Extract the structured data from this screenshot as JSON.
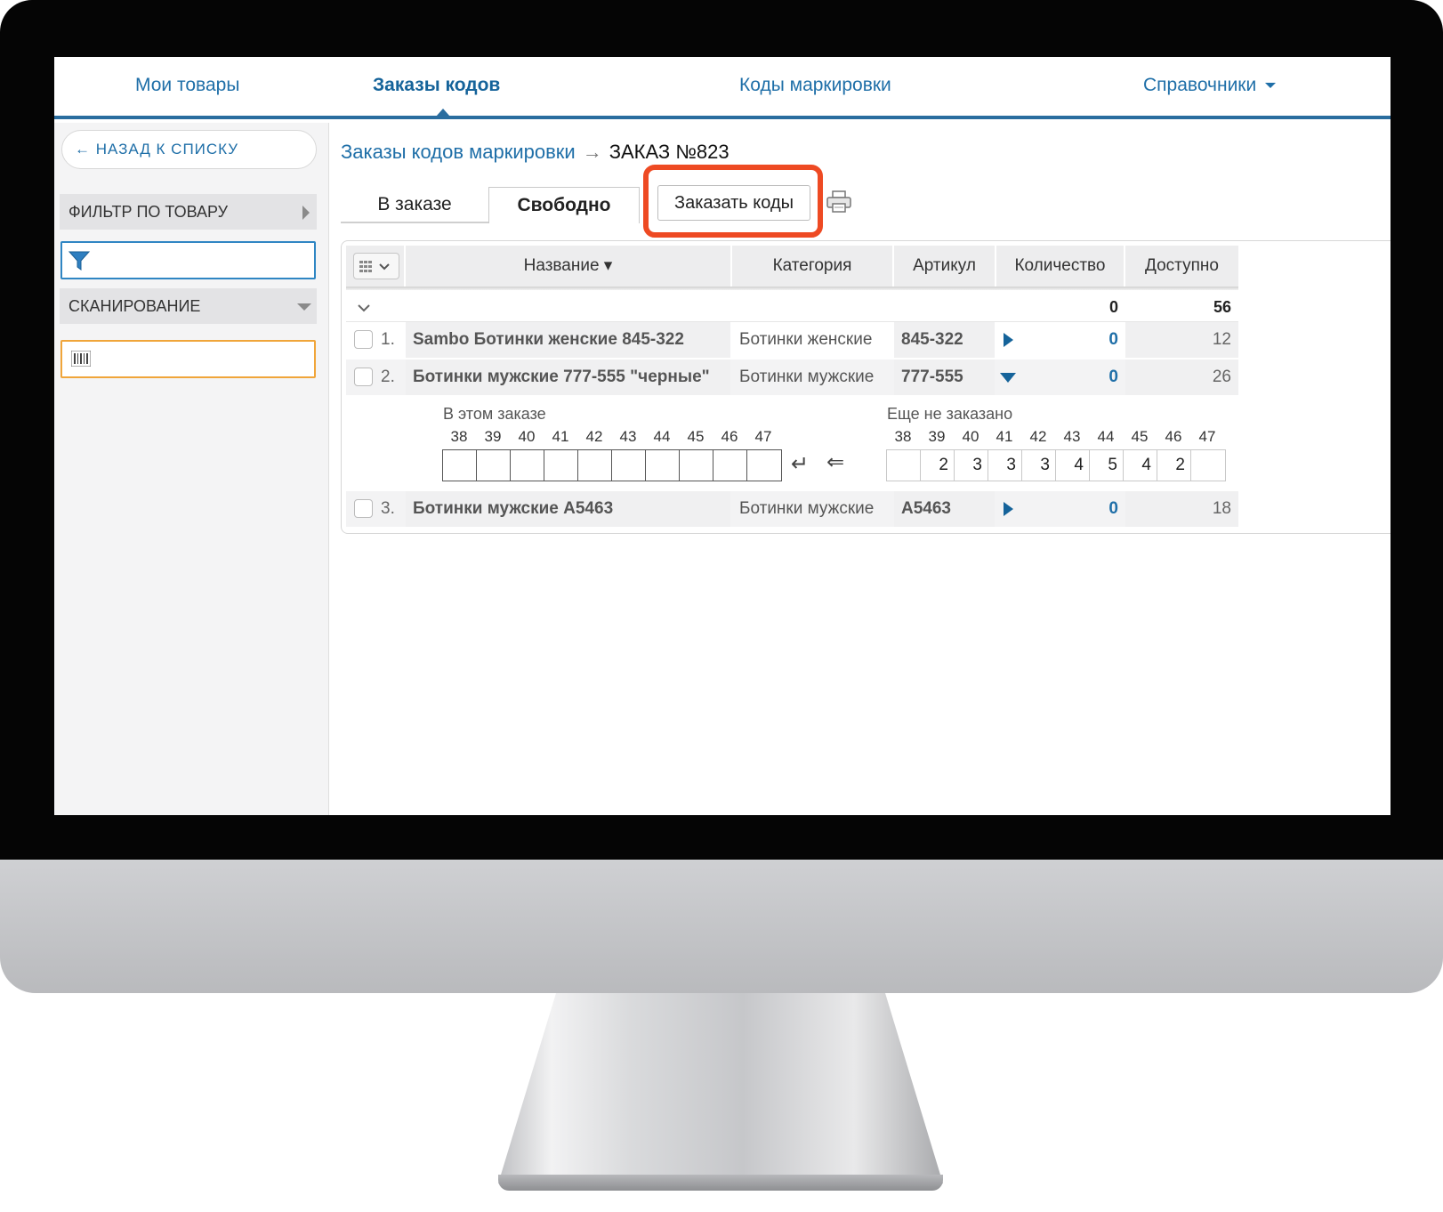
{
  "nav": {
    "items": [
      {
        "label": "Мои товары"
      },
      {
        "label": "Заказы кодов"
      },
      {
        "label": "Коды маркировки"
      },
      {
        "label": "Справочники"
      }
    ]
  },
  "sidebar": {
    "back_label": "← НАЗАД К СПИСКУ",
    "filter_title": "ФИЛЬТР ПО ТОВАРУ",
    "filter_value": "",
    "scan_title": "СКАНИРОВАНИЕ",
    "scan_value": ""
  },
  "breadcrumb": {
    "parent": "Заказы кодов маркировки",
    "arrow": "→",
    "current": "ЗАКАЗ №823"
  },
  "tabs": [
    {
      "label": "В заказе"
    },
    {
      "label": "Свободно"
    }
  ],
  "actions": {
    "order_codes": "Заказать коды"
  },
  "table": {
    "columns": [
      "Название ▾",
      "Категория",
      "Артикул",
      "Количество",
      "Доступно"
    ],
    "totals": {
      "quantity": "0",
      "available": "56"
    },
    "rows": [
      {
        "num": "1.",
        "name": "Sambo Ботинки женские 845-322",
        "category": "Ботинки женские",
        "article": "845-322",
        "quantity": "0",
        "available": "12"
      },
      {
        "num": "2.",
        "name": "Ботинки мужские 777-555 \"черные\"",
        "category": "Ботинки мужские",
        "article": "777-555",
        "quantity": "0",
        "available": "26"
      },
      {
        "num": "3.",
        "name": "Ботинки мужские A5463",
        "category": "Ботинки мужские",
        "article": "A5463",
        "quantity": "0",
        "available": "18"
      }
    ]
  },
  "detail": {
    "in_order_title": "В этом заказе",
    "not_ordered_title": "Еще не заказано",
    "sizes": [
      "38",
      "39",
      "40",
      "41",
      "42",
      "43",
      "44",
      "45",
      "46",
      "47"
    ],
    "in_order_values": [
      "",
      "",
      "",
      "",
      "",
      "",
      "",
      "",
      "",
      ""
    ],
    "not_ordered_values": [
      "",
      "2",
      "3",
      "3",
      "3",
      "4",
      "5",
      "4",
      "2",
      ""
    ],
    "enter_symbol": "↵",
    "back_symbol": "⇐"
  },
  "colors": {
    "accent": "#1f6fa8",
    "nav_border": "#2a6d9f",
    "highlight": "#ee4a23",
    "scan_border": "#f0a53a"
  }
}
